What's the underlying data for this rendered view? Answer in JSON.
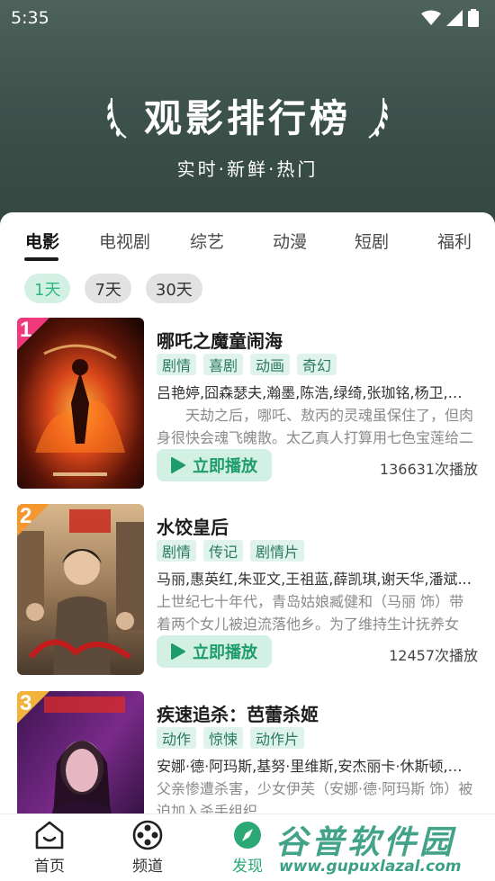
{
  "status_bar": {
    "time": "5:35"
  },
  "hero": {
    "title": "观影排行榜",
    "subtitle": "实时·新鲜·热门"
  },
  "tabs": [
    "电影",
    "电视剧",
    "综艺",
    "动漫",
    "短剧",
    "福利"
  ],
  "period_chips": [
    "1天",
    "7天",
    "30天"
  ],
  "play_label": "立即播放",
  "movies": [
    {
      "rank": "1",
      "title": "哪吒之魔童闹海",
      "tags": [
        "剧情",
        "喜剧",
        "动画",
        "奇幻"
      ],
      "cast": "吕艳婷,囧森瑟夫,瀚墨,陈浩,绿绮,张珈铭,杨卫,王...",
      "desc": "天劫之后，哪吒、敖丙的灵魂虽保住了，但肉身很快会魂飞魄散。太乙真人打算用七色宝莲给二",
      "plays": "136631次播放",
      "badge_color": "#f0397a"
    },
    {
      "rank": "2",
      "title": "水饺皇后",
      "tags": [
        "剧情",
        "传记",
        "剧情片"
      ],
      "cast": "马丽,惠英红,朱亚文,王祖蓝,薛凯琪,谢天华,潘斌...",
      "desc": "上世纪七十年代，青岛姑娘臧健和（马丽 饰）带着两个女儿被迫流落他乡。为了维持生计抚养女儿，",
      "plays": "12457次播放",
      "badge_color": "#f4972e"
    },
    {
      "rank": "3",
      "title": "疾速追杀：芭蕾杀姬",
      "tags": [
        "动作",
        "惊悚",
        "动作片"
      ],
      "cast": "安娜·德·阿玛斯,基努·里维斯,安杰丽卡·休斯顿,加...",
      "desc": "父亲惨遭杀害，少女伊芙（安娜·德·阿玛斯 饰）被迫加入杀手组织",
      "plays": "",
      "badge_color": "#f2b33c"
    }
  ],
  "bottom_nav": [
    "首页",
    "频道",
    "发现"
  ],
  "watermark": {
    "text": "谷普软件园",
    "url": "www.gupuxlazal.com"
  }
}
